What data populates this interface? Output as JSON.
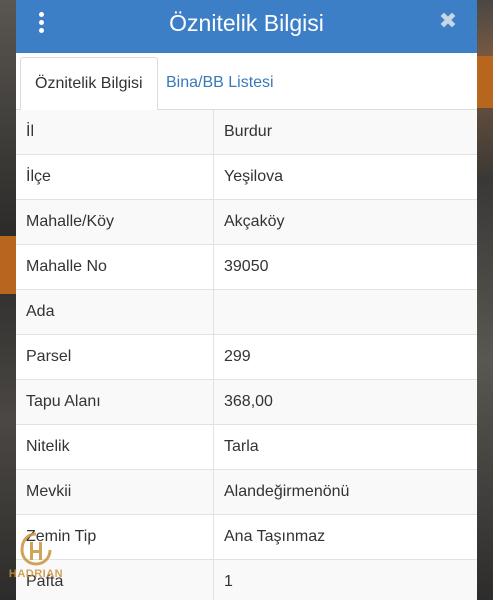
{
  "dialog": {
    "title": "Öznitelik Bilgisi"
  },
  "tabs": [
    {
      "label": "Öznitelik Bilgisi",
      "active": true
    },
    {
      "label": "Bina/BB Listesi",
      "active": false
    }
  ],
  "rows": [
    {
      "key": "İl",
      "value": "Burdur"
    },
    {
      "key": "İlçe",
      "value": "Yeşilova"
    },
    {
      "key": "Mahalle/Köy",
      "value": "Akçaköy"
    },
    {
      "key": "Mahalle No",
      "value": "39050"
    },
    {
      "key": "Ada",
      "value": ""
    },
    {
      "key": "Parsel",
      "value": "299"
    },
    {
      "key": "Tapu Alanı",
      "value": "368,00"
    },
    {
      "key": "Nitelik",
      "value": "Tarla"
    },
    {
      "key": "Mevkii",
      "value": "Alandeğirmenönü"
    },
    {
      "key": "Zemin Tip",
      "value": "Ana Taşınmaz"
    },
    {
      "key": "Pafta",
      "value": "1"
    }
  ],
  "watermark": {
    "brand": "HADRIAN"
  },
  "colors": {
    "titlebar": "#3d7fc6",
    "link": "#3a79b8",
    "watermark": "#c9943e"
  },
  "icons": {
    "menu": "kebab-menu-icon",
    "close": "close-icon"
  }
}
